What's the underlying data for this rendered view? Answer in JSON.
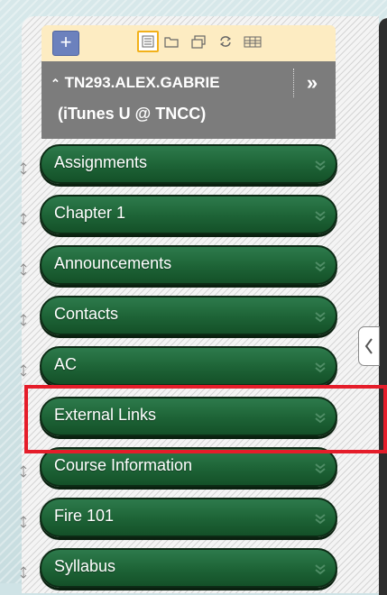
{
  "colors": {
    "accent_highlight": "#e51d2a",
    "pill_green": "#1d6336",
    "toolbar_bg": "#fdecc2",
    "header_bg": "#7c7c7c",
    "add_button": "#6c81bd"
  },
  "toolbar": {
    "add_icon": "plus-icon",
    "icons": [
      "list-view-icon",
      "folder-icon",
      "window-icon",
      "refresh-icon",
      "grid-icon"
    ],
    "active_icon": "list-view-icon"
  },
  "header": {
    "title": "TN293.ALEX.GABRIE",
    "subtitle": "(iTunes U @ TNCC)",
    "collapse_icon": "double-chevron-up-icon",
    "expand_icon": "double-chevron-right-icon"
  },
  "nav": {
    "items": [
      {
        "label": "Assignments"
      },
      {
        "label": "Chapter 1"
      },
      {
        "label": "Announcements"
      },
      {
        "label": "Contacts"
      },
      {
        "label": "AC"
      },
      {
        "label": "External Links",
        "highlighted": true
      },
      {
        "label": "Course Information"
      },
      {
        "label": "Fire 101"
      },
      {
        "label": "Syllabus"
      }
    ]
  },
  "panel_toggle_icon": "chevron-left-icon"
}
